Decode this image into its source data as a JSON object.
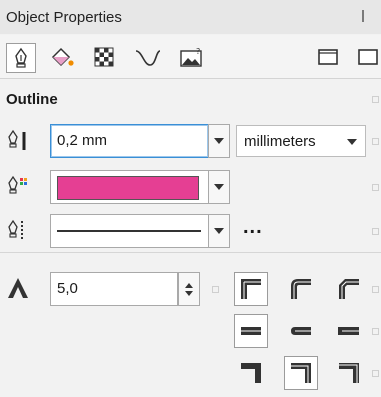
{
  "panel": {
    "title": "Object Properties",
    "section_title": "Outline"
  },
  "toolbar": {
    "tabs": [
      {
        "icon": "pen-outline-icon",
        "selected": true
      },
      {
        "icon": "fill-bucket-icon",
        "selected": false
      },
      {
        "icon": "transparency-checker-icon",
        "selected": false
      },
      {
        "icon": "curve-icon",
        "selected": false
      },
      {
        "icon": "image-properties-icon",
        "selected": false
      }
    ],
    "right_icons": [
      "frame-icon",
      "frame-icon-2"
    ]
  },
  "outline": {
    "width_value": "0,2 mm",
    "units_value": "millimeters",
    "color_hex": "#e53f93",
    "line_style": "solid",
    "more_label": "..."
  },
  "miter": {
    "value": "5,0"
  },
  "colors": {
    "focus_border": "#3a8fd6",
    "swatch": "#e53f93"
  }
}
